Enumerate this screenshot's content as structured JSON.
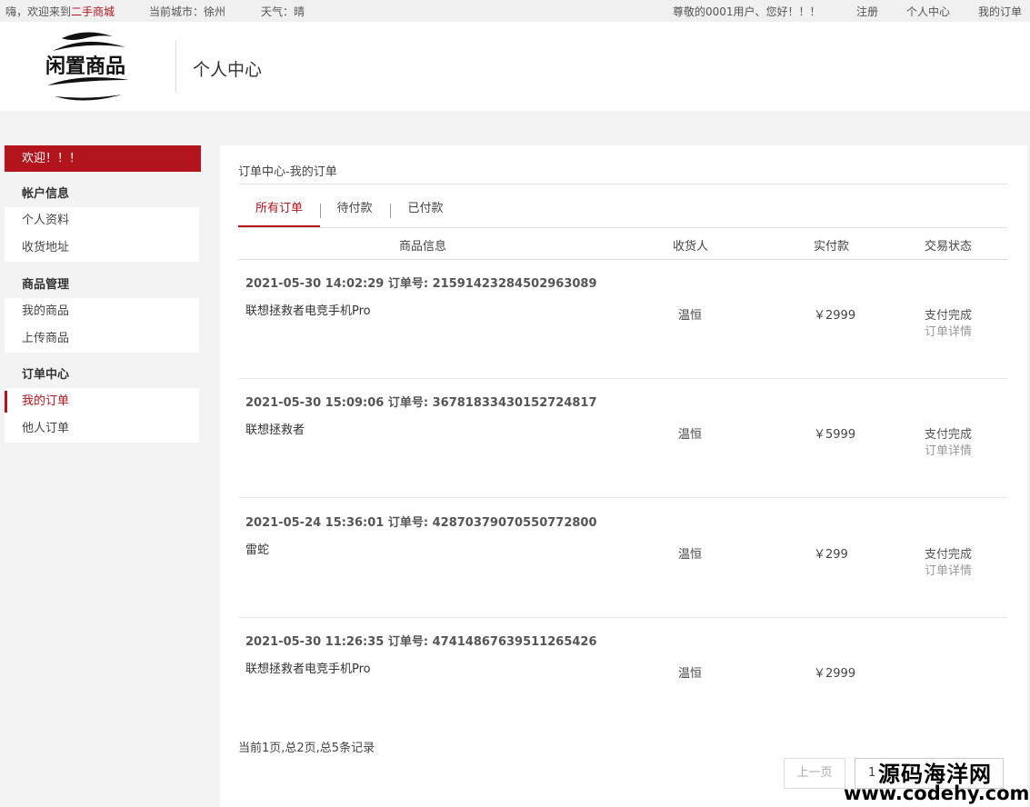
{
  "topbar": {
    "greeting": "嗨，欢迎来到",
    "site_name": "二手商城",
    "city_label": "当前城市：",
    "city": "徐州",
    "weather_label": "天气：",
    "weather": "晴",
    "user_greeting": "尊敬的0001用户、您好！！！",
    "register": "注册",
    "personal_center": "个人中心",
    "my_orders": "我的订单"
  },
  "header": {
    "logo_text": "闲置商品",
    "title": "个人中心"
  },
  "sidebar": {
    "welcome": "欢迎！！！",
    "groups": [
      {
        "head": "帐户信息",
        "items": [
          "个人资料",
          "收货地址"
        ]
      },
      {
        "head": "商品管理",
        "items": [
          "我的商品",
          "上传商品"
        ]
      },
      {
        "head": "订单中心",
        "items": [
          "我的订单",
          "他人订单"
        ]
      }
    ]
  },
  "main": {
    "breadcrumb": "订单中心-我的订单",
    "tabs": [
      "所有订单",
      "待付款",
      "已付款"
    ],
    "columns": [
      "商品信息",
      "收货人",
      "实付款",
      "交易状态"
    ],
    "orders": [
      {
        "meta": "2021-05-30 14:02:29 订单号: 21591423284502963089",
        "product": "联想拯救者电竞手机Pro",
        "receiver": "温恒",
        "price": "￥2999",
        "status": "支付完成",
        "detail": "订单详情"
      },
      {
        "meta": "2021-05-30 15:09:06 订单号: 36781833430152724817",
        "product": "联想拯救者",
        "receiver": "温恒",
        "price": "￥5999",
        "status": "支付完成",
        "detail": "订单详情"
      },
      {
        "meta": "2021-05-24 15:36:01 订单号: 42870379070550772800",
        "product": "雷蛇",
        "receiver": "温恒",
        "price": "￥299",
        "status": "支付完成",
        "detail": "订单详情"
      },
      {
        "meta": "2021-05-30 11:26:35 订单号: 47414867639511265426",
        "product": "联想拯救者电竞手机Pro",
        "receiver": "温恒",
        "price": "￥2999",
        "status": "",
        "detail": ""
      }
    ],
    "page_info": "当前1页,总2页,总5条记录",
    "prev_label": "上一页",
    "current_page": "1"
  },
  "watermark": {
    "cn": "源码海洋网",
    "en": "www.codehy.com"
  },
  "colors": {
    "accent": "#b4141c"
  }
}
